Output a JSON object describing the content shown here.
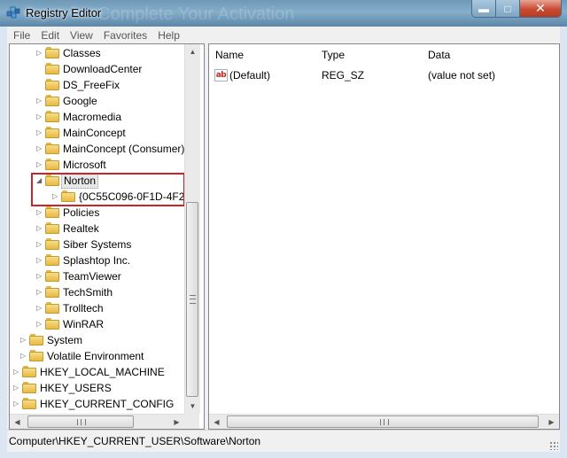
{
  "window": {
    "title": "Registry Editor",
    "background_ghost_text": "Complete Your Activation"
  },
  "caption_buttons": {
    "minimize": "▬",
    "maximize": "□",
    "close": "✕"
  },
  "menu": {
    "items": [
      "File",
      "Edit",
      "View",
      "Favorites",
      "Help"
    ]
  },
  "tree": {
    "items": [
      {
        "label": "Classes",
        "level": 2,
        "expander": "collapsed"
      },
      {
        "label": "DownloadCenter",
        "level": 2,
        "expander": "none"
      },
      {
        "label": "DS_FreeFix",
        "level": 2,
        "expander": "none"
      },
      {
        "label": "Google",
        "level": 2,
        "expander": "collapsed"
      },
      {
        "label": "Macromedia",
        "level": 2,
        "expander": "collapsed"
      },
      {
        "label": "MainConcept",
        "level": 2,
        "expander": "collapsed"
      },
      {
        "label": "MainConcept (Consumer)",
        "level": 2,
        "expander": "collapsed"
      },
      {
        "label": "Microsoft",
        "level": 2,
        "expander": "collapsed"
      },
      {
        "label": "Norton",
        "level": 2,
        "expander": "expanded",
        "selected": true
      },
      {
        "label": "{0C55C096-0F1D-4F28",
        "level": 3,
        "expander": "collapsed"
      },
      {
        "label": "Policies",
        "level": 2,
        "expander": "collapsed"
      },
      {
        "label": "Realtek",
        "level": 2,
        "expander": "collapsed"
      },
      {
        "label": "Siber Systems",
        "level": 2,
        "expander": "collapsed"
      },
      {
        "label": "Splashtop Inc.",
        "level": 2,
        "expander": "collapsed"
      },
      {
        "label": "TeamViewer",
        "level": 2,
        "expander": "collapsed"
      },
      {
        "label": "TechSmith",
        "level": 2,
        "expander": "collapsed"
      },
      {
        "label": "Trolltech",
        "level": 2,
        "expander": "collapsed"
      },
      {
        "label": "WinRAR",
        "level": 2,
        "expander": "collapsed"
      },
      {
        "label": "System",
        "level": 1,
        "expander": "collapsed"
      },
      {
        "label": "Volatile Environment",
        "level": 1,
        "expander": "collapsed"
      },
      {
        "label": "HKEY_LOCAL_MACHINE",
        "level": 0,
        "expander": "collapsed"
      },
      {
        "label": "HKEY_USERS",
        "level": 0,
        "expander": "collapsed"
      },
      {
        "label": "HKEY_CURRENT_CONFIG",
        "level": 0,
        "expander": "collapsed"
      }
    ]
  },
  "list": {
    "columns": [
      "Name",
      "Type",
      "Data"
    ],
    "rows": [
      {
        "name": "(Default)",
        "type": "REG_SZ",
        "data": "(value not set)",
        "icon_text": "ab"
      }
    ]
  },
  "status": {
    "path": "Computer\\HKEY_CURRENT_USER\\Software\\Norton"
  },
  "colors": {
    "highlight_box": "#c8252a",
    "folder": "#e8b944",
    "titlebar": "#6f98b7"
  }
}
